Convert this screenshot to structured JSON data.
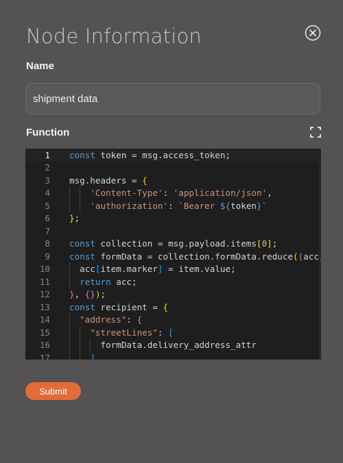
{
  "dialog": {
    "title": "Node Information",
    "close_icon": "close-circle-icon"
  },
  "name": {
    "label": "Name",
    "value": "shipment data"
  },
  "function": {
    "label": "Function",
    "expand_icon": "fullscreen-icon"
  },
  "editor": {
    "language": "javascript",
    "active_line": 1,
    "lines": [
      {
        "n": "1",
        "text": "const token = msg.access_token;"
      },
      {
        "n": "2",
        "text": ""
      },
      {
        "n": "3",
        "text": "msg.headers = {"
      },
      {
        "n": "4",
        "text": "    'Content-Type': 'application/json',"
      },
      {
        "n": "5",
        "text": "    'authorization': `Bearer ${token}`"
      },
      {
        "n": "6",
        "text": "};"
      },
      {
        "n": "7",
        "text": ""
      },
      {
        "n": "8",
        "text": "const collection = msg.payload.items[0];"
      },
      {
        "n": "9",
        "text": "const formData = collection.formData.reduce((acc,"
      },
      {
        "n": "10",
        "text": "  acc[item.marker] = item.value;"
      },
      {
        "n": "11",
        "text": "  return acc;"
      },
      {
        "n": "12",
        "text": "}, {});"
      },
      {
        "n": "13",
        "text": "const recipient = {"
      },
      {
        "n": "14",
        "text": "  \"address\": {"
      },
      {
        "n": "15",
        "text": "    \"streetLines\": ["
      },
      {
        "n": "16",
        "text": "      formData.delivery_address_attr"
      },
      {
        "n": "17",
        "text": "    ],"
      }
    ],
    "colors": {
      "background": "#1e1e1e",
      "keyword": "#569cd6",
      "string": "#ce9178",
      "number": "#b5cea8",
      "bracket_level_1": "#ffd700",
      "bracket_level_2": "#da70d6",
      "bracket_level_3": "#179fff"
    }
  },
  "actions": {
    "submit_label": "Submit",
    "accent_color": "#e36b37"
  }
}
